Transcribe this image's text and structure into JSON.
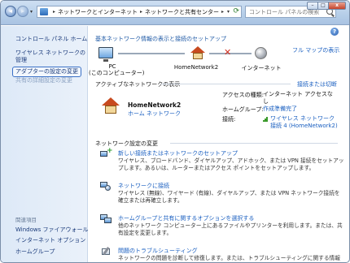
{
  "address_bar": {
    "crumbs": [
      "ネットワークとインターネット",
      "ネットワークと共有センター"
    ]
  },
  "search": {
    "placeholder": "コントロール パネルの検索"
  },
  "sidebar": {
    "home": "コントロール パネル ホーム",
    "wireless": "ワイヤレス ネットワークの管理",
    "adapter": "アダプターの設定の変更",
    "sharing": "共有の詳細設定の変更",
    "section_title": "関連項目",
    "links": [
      "Windows ファイアウォール",
      "インターネット オプション",
      "ホームグループ"
    ]
  },
  "main": {
    "heading": "基本ネットワーク情報の表示と接続のセットアップ",
    "full_map": "フル マップの表示",
    "map": {
      "pc_label_1": "PC",
      "pc_label_2": "(このコンピューター)",
      "home_label": "HomeNetwork2",
      "internet_label": "インターネット"
    },
    "active": {
      "title": "アクティブなネットワークの表示",
      "connect_link": "接続または切断",
      "network_name": "HomeNetwork2",
      "network_type": "ホーム ネットワーク",
      "access_label": "アクセスの種類:",
      "access_value": "インターネット アクセスなし",
      "homegroup_label": "ホームグループ:",
      "homegroup_value": "作成準備完了",
      "connection_label": "接続:",
      "connection_value": "ワイヤレス ネットワーク接続 4 (HomeNetwork2)"
    },
    "change": {
      "title": "ネットワーク設定の変更",
      "tasks": [
        {
          "link": "新しい接続またはネットワークのセットアップ",
          "desc": "ワイヤレス、ブロードバンド、ダイヤルアップ、アドホック、または VPN 接続をセットアップします。あるいは、ルーターまたはアクセス ポイントをセットアップします。"
        },
        {
          "link": "ネットワークに接続",
          "desc": "ワイヤレス (無線)、ワイヤード (有線)、ダイヤルアップ、または VPN ネットワーク接続を確立または再確立します。"
        },
        {
          "link": "ホームグループと共有に関するオプションを選択する",
          "desc": "他のネットワーク コンピューター上にあるファイルやプリンターを利用します。または、共有設定を変更します。"
        },
        {
          "link": "問題のトラブルシューティング",
          "desc": "ネットワークの問題を診断して修復します。または、トラブルシューティングに関する情報を入手します。"
        }
      ]
    }
  }
}
